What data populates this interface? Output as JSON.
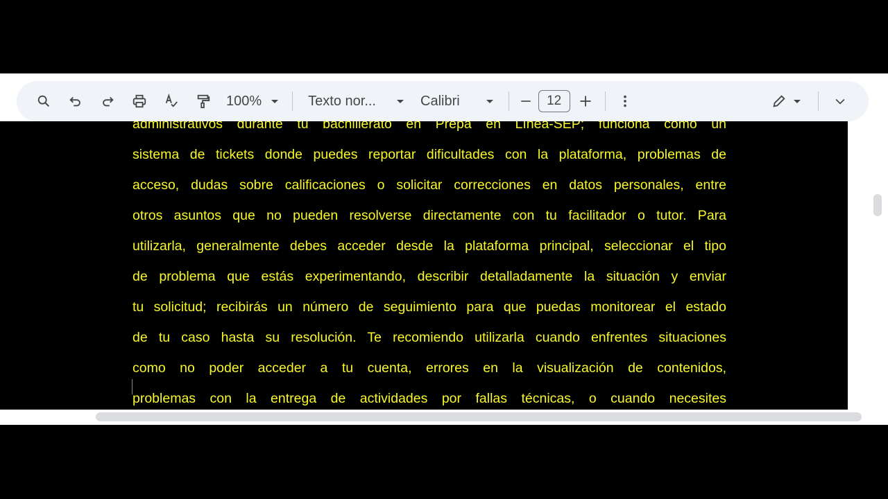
{
  "toolbar": {
    "zoom": "100%",
    "style": "Texto nor...",
    "font": "Calibri",
    "font_size": "12",
    "icons": [
      "search-icon",
      "undo-icon",
      "redo-icon",
      "print-icon",
      "spellcheck-icon",
      "paint-format-icon",
      "minus-icon",
      "plus-icon",
      "more-vert-icon",
      "pencil-icon",
      "chevron-down-icon"
    ]
  },
  "document": {
    "text_color": "#f7f72a",
    "lines": [
      "administrativos durante tu bachillerato en Prepa en Línea-SEP; funciona como un",
      "sistema de tickets donde puedes reportar dificultades con la plataforma, problemas de",
      "acceso, dudas sobre calificaciones o solicitar correcciones en datos personales, entre",
      "otros asuntos que no pueden resolverse directamente con tu facilitador o tutor. Para",
      "utilizarla, generalmente debes acceder desde la plataforma principal, seleccionar el tipo",
      "de problema que estás experimentando, describir detalladamente la situación y enviar",
      "tu solicitud; recibirás un número de seguimiento para que puedas monitorear el estado",
      "de tu caso hasta su resolución. Te recomiendo utilizarla cuando enfrentes situaciones",
      "como no poder acceder a tu cuenta, errores en la visualización de contenidos,",
      "problemas con la entrega de actividades por fallas técnicas, o cuando necesites"
    ]
  }
}
